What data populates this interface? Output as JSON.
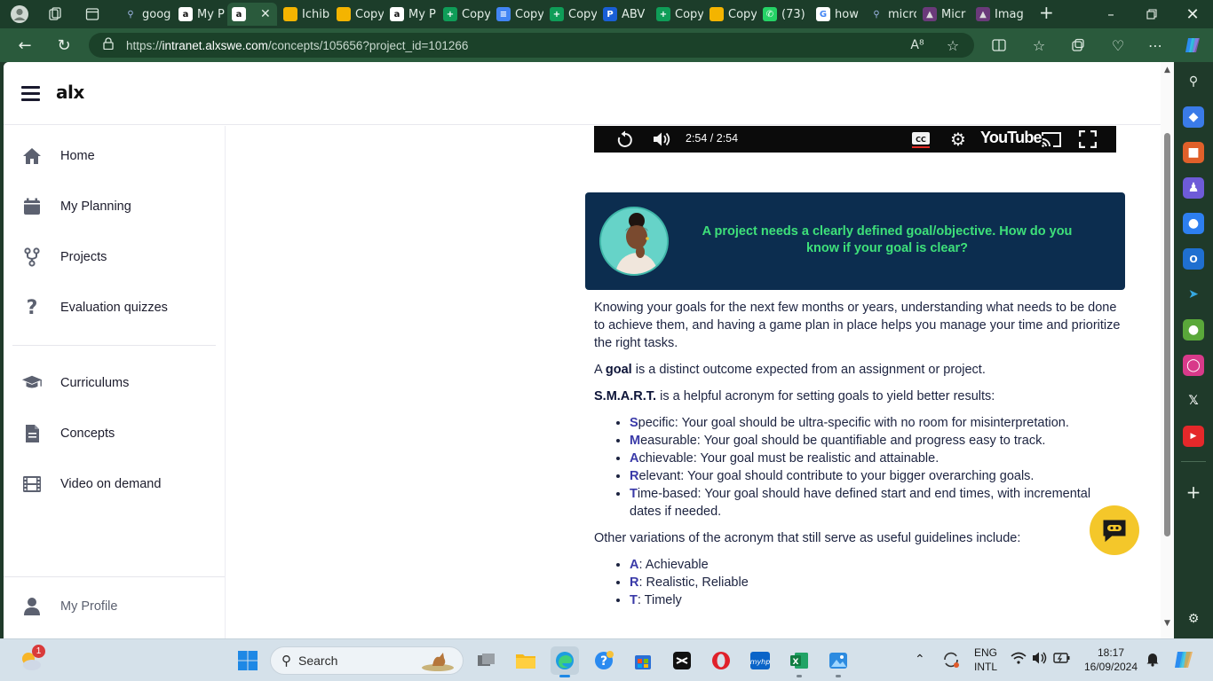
{
  "browser": {
    "tabs": [
      {
        "label": "goog",
        "fav": "search"
      },
      {
        "label": "My P",
        "fav": "alx"
      },
      {
        "label": "",
        "fav": "alx",
        "active": true
      },
      {
        "label": "Ichib",
        "fav": "slides"
      },
      {
        "label": "Copy",
        "fav": "slides"
      },
      {
        "label": "My P",
        "fav": "alx"
      },
      {
        "label": "Copy",
        "fav": "sheets"
      },
      {
        "label": "Copy",
        "fav": "docs"
      },
      {
        "label": "Copy",
        "fav": "sheets"
      },
      {
        "label": "ABV",
        "fav": "p"
      },
      {
        "label": "Copy",
        "fav": "sheets"
      },
      {
        "label": "Copy",
        "fav": "slides"
      },
      {
        "label": "(73)",
        "fav": "whatsapp"
      },
      {
        "label": "how",
        "fav": "google"
      },
      {
        "label": "micro",
        "fav": "search"
      },
      {
        "label": "Micr",
        "fav": "copilot"
      },
      {
        "label": "Imag",
        "fav": "copilot"
      }
    ],
    "url_scheme": "https://",
    "url_host": "intranet.alxswe.com",
    "url_path": "/concepts/105656?project_id=101266"
  },
  "app": {
    "logo": "alx"
  },
  "sidebar": {
    "items": [
      {
        "label": "Home",
        "icon": "home-icon"
      },
      {
        "label": "My Planning",
        "icon": "calendar-icon"
      },
      {
        "label": "Projects",
        "icon": "fork-icon"
      },
      {
        "label": "Evaluation quizzes",
        "icon": "question-icon"
      },
      {
        "label": "Curriculums",
        "icon": "graduation-cap-icon"
      },
      {
        "label": "Concepts",
        "icon": "document-icon"
      },
      {
        "label": "Video on demand",
        "icon": "film-icon"
      }
    ],
    "profile_label": "My Profile"
  },
  "video": {
    "time": "2:54 / 2:54",
    "brand": "YouTube"
  },
  "callout": {
    "question": "A project needs a clearly defined goal/objective. How do you know if your goal is clear?"
  },
  "article": {
    "intro": "Knowing your goals for the next few months or years, understanding what needs to be done to achieve them, and having a game plan in place helps you manage your time and prioritize the right tasks.",
    "goal_prefix": "A ",
    "goal_word": "goal",
    "goal_rest": " is a distinct outcome expected from an assignment or project.",
    "smart_word": "S.M.A.R.T.",
    "smart_rest": " is a helpful acronym for setting goals to yield better results:",
    "smart_items": [
      {
        "letter": "S",
        "rest": "pecific: Your goal should be ultra-specific with no room for misinterpretation."
      },
      {
        "letter": "M",
        "rest": "easurable: Your goal should be quantifiable and progress easy to track."
      },
      {
        "letter": "A",
        "rest": "chievable: Your goal must be realistic and attainable."
      },
      {
        "letter": "R",
        "rest": "elevant: Your goal should contribute to your bigger overarching goals."
      },
      {
        "letter": "T",
        "rest": "ime-based: Your goal should have defined start and end times, with incremental dates if needed."
      }
    ],
    "variations_intro": "Other variations of the acronym that still serve as useful guidelines include:",
    "variations": [
      {
        "letter": "A",
        "rest": ": Achievable"
      },
      {
        "letter": "R",
        "rest": ": Realistic, Reliable"
      },
      {
        "letter": "T",
        "rest": ": Timely"
      }
    ]
  },
  "taskbar": {
    "search_label": "Search",
    "weather_badge": "1",
    "lang_line1": "ENG",
    "lang_line2": "INTL",
    "time": "18:17",
    "date": "16/09/2024"
  },
  "colors": {
    "accent_letter": "#3a3aa8",
    "callout_bg": "#0c2d4f",
    "callout_text": "#3ee07a",
    "chat_bubble": "#f4c72a",
    "browser_frame": "#2a5a3c"
  }
}
